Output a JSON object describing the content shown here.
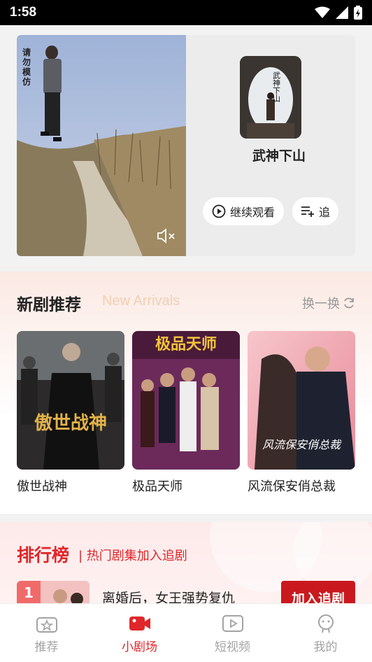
{
  "status_bar": {
    "time": "1:58"
  },
  "hero": {
    "watermark": "请勿模仿",
    "poster_text": "武神下山",
    "title": "武神下山",
    "continue_label": "继续观看",
    "follow_label": "追"
  },
  "new_arrivals": {
    "title": "新剧推荐",
    "subtitle": "New Arrivals",
    "refresh_label": "换一换",
    "items": [
      {
        "name": "傲世战神",
        "cover_text": "傲世战神"
      },
      {
        "name": "极品天师",
        "cover_text": "极品天师"
      },
      {
        "name": "风流保安俏总裁",
        "cover_text": "风流保安俏总裁"
      }
    ]
  },
  "ranking": {
    "title": "排行榜",
    "subtitle": "| 热门剧集加入追剧",
    "items": [
      {
        "rank": "1",
        "name": "离婚后，女王强势复仇",
        "button": "加入追剧"
      }
    ]
  },
  "tabs": [
    {
      "label": "推荐",
      "icon": "recommend-icon",
      "active": false
    },
    {
      "label": "小剧场",
      "icon": "theater-camera-icon",
      "active": true
    },
    {
      "label": "短视频",
      "icon": "short-video-icon",
      "active": false
    },
    {
      "label": "我的",
      "icon": "profile-icon",
      "active": false
    }
  ],
  "colors": {
    "accent": "#e0262a",
    "button": "#c9191e",
    "subtitle": "#f1cfb2"
  }
}
